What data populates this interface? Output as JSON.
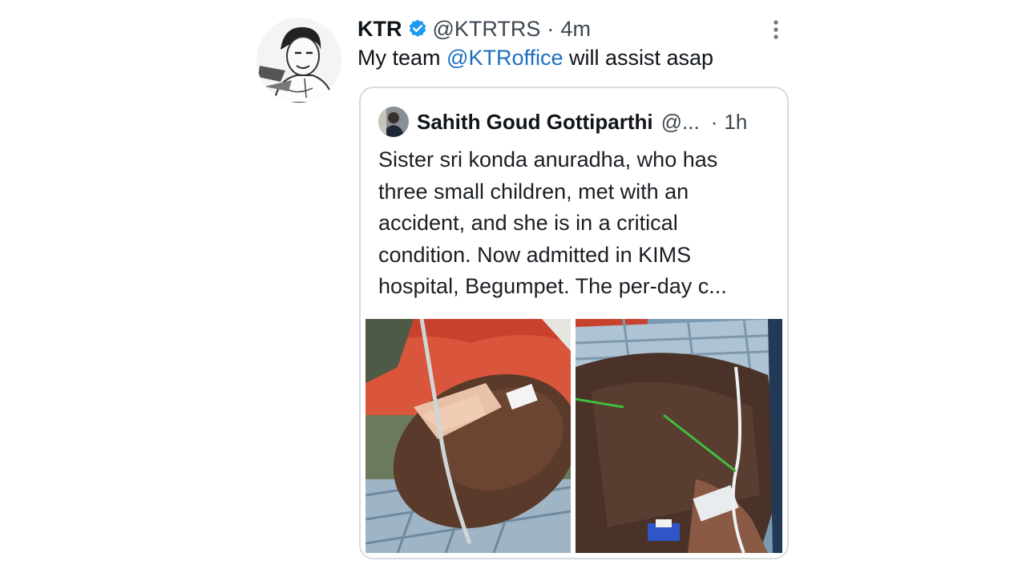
{
  "tweet": {
    "author_name": "KTR",
    "handle": "@KTRTRS",
    "separator": "·",
    "time": "4m",
    "text_before": "My team ",
    "mention": "@KTRoffice",
    "text_after": " will assist asap",
    "verified_icon": "verified-badge-icon",
    "more_icon": "more-vertical-icon"
  },
  "quote": {
    "author_name": "Sahith Goud Gottiparthi",
    "handle": "@...",
    "separator": "·",
    "time": "1h",
    "text": "Sister sri konda anuradha, who has three small children, met with an accident, and she is in a critical condition. Now admitted in KIMS hospital, Begumpet. The per-day c...",
    "photos": [
      "photo-patient-face",
      "photo-patient-arm"
    ]
  },
  "colors": {
    "link": "#1d6fbf",
    "verified": "#1d9bf0",
    "border": "#d6dbe0",
    "secondary_text": "#3d4650"
  }
}
